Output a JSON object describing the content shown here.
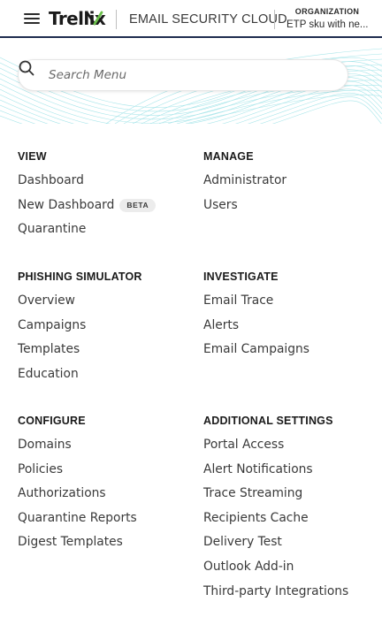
{
  "header": {
    "logo_text": "Trellix",
    "product_name": "EMAIL SECURITY CLOUD",
    "org_label": "ORGANIZATION",
    "org_value": "ETP sku with ne..."
  },
  "search": {
    "placeholder": "Search Menu"
  },
  "sections": {
    "view": {
      "title": "VIEW",
      "items": [
        "Dashboard",
        "New Dashboard",
        "Quarantine"
      ],
      "badge": "BETA"
    },
    "manage": {
      "title": "MANAGE",
      "items": [
        "Administrator",
        "Users"
      ]
    },
    "phishing": {
      "title": "PHISHING SIMULATOR",
      "items": [
        "Overview",
        "Campaigns",
        "Templates",
        "Education"
      ]
    },
    "investigate": {
      "title": "INVESTIGATE",
      "items": [
        "Email Trace",
        "Alerts",
        "Email Campaigns"
      ]
    },
    "configure": {
      "title": "CONFIGURE",
      "items": [
        "Domains",
        "Policies",
        "Authorizations",
        "Quarantine Reports",
        "Digest Templates"
      ]
    },
    "additional": {
      "title": "ADDITIONAL SETTINGS",
      "items": [
        "Portal Access",
        "Alert Notifications",
        "Trace Streaming",
        "Recipients Cache",
        "Delivery Test",
        "Outlook Add-in",
        "Third-party Integrations"
      ]
    }
  },
  "colors": {
    "header_border": "#1f2c4f",
    "wave": "#5fd0d8",
    "logo_accent": "#6bc04b"
  },
  "icons": [
    "hamburger-menu-icon",
    "search-icon",
    "trellix-logo-mark"
  ]
}
